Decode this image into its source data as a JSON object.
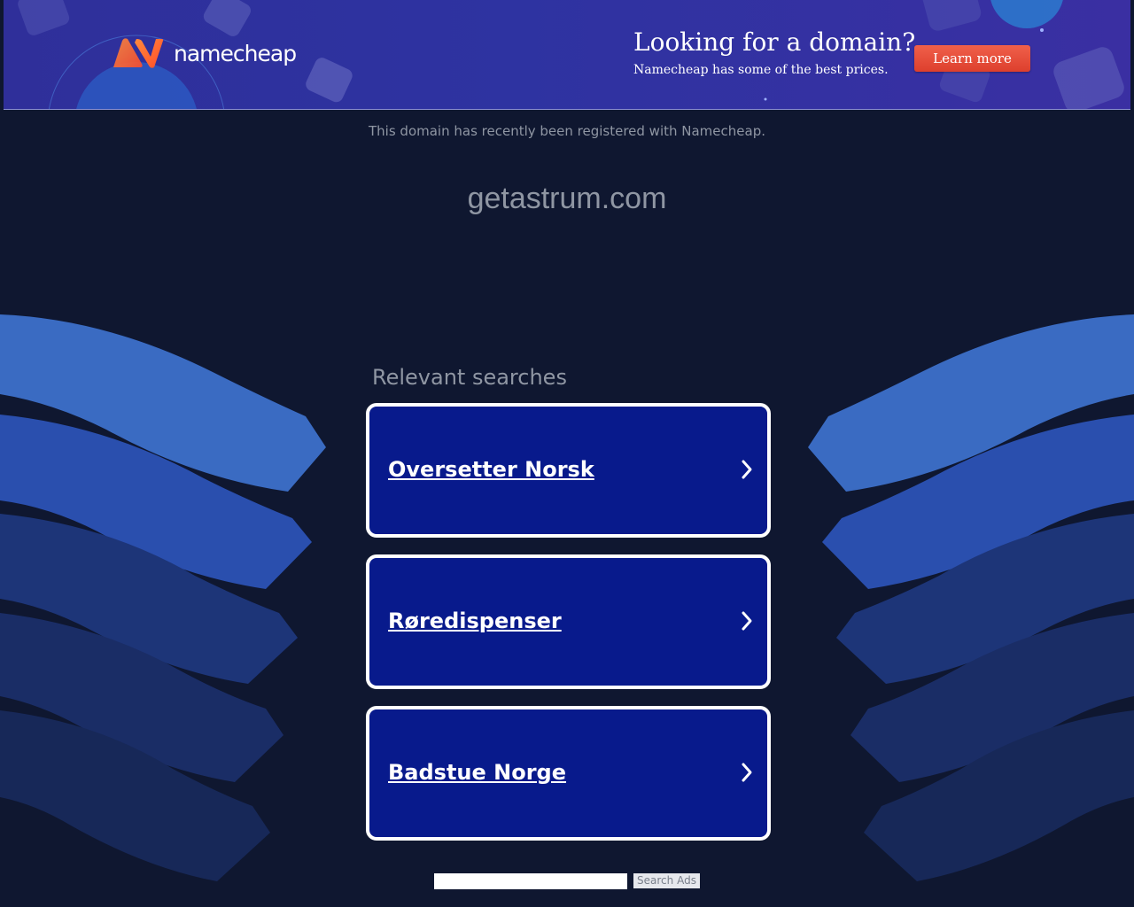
{
  "banner": {
    "logo_text": "namecheap",
    "promo_title": "Looking for a domain?",
    "promo_subtitle": "Namecheap has some of the best prices.",
    "cta_label": "Learn more"
  },
  "page": {
    "registered_note": "This domain has recently been registered with Namecheap.",
    "domain_name": "getastrum.com"
  },
  "searches": {
    "heading": "Relevant searches",
    "items": [
      {
        "label": "Oversetter Norsk"
      },
      {
        "label": "Røredispenser"
      },
      {
        "label": "Badstue Norge"
      }
    ]
  },
  "search_ads": {
    "input_value": "",
    "button_label": "Search Ads"
  },
  "colors": {
    "background": "#0f1730",
    "card_background": "#081a8c",
    "cta": "#e5452f",
    "muted_text": "#8f96a3"
  }
}
